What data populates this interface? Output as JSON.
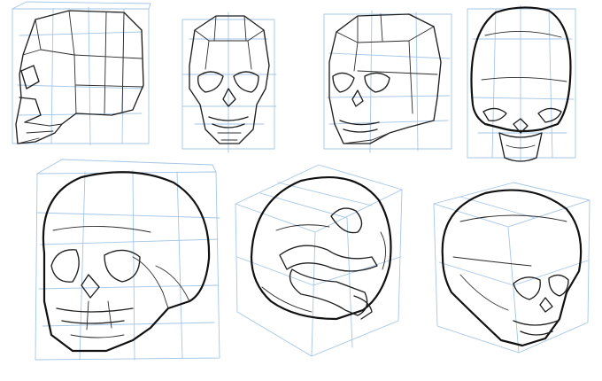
{
  "artwork": {
    "subject": "skull-construction-sketch",
    "ink_color": "#1f1f1f",
    "guide_color": "#9fc3e6",
    "background": "#ffffff",
    "studies": [
      {
        "view": "side-profile-planar"
      },
      {
        "view": "front-planar"
      },
      {
        "view": "three-quarter-planar"
      },
      {
        "view": "top-down-foreshortened"
      },
      {
        "view": "three-quarter-large"
      },
      {
        "view": "back-tilted-rotated"
      },
      {
        "view": "three-quarter-right-low"
      }
    ]
  }
}
